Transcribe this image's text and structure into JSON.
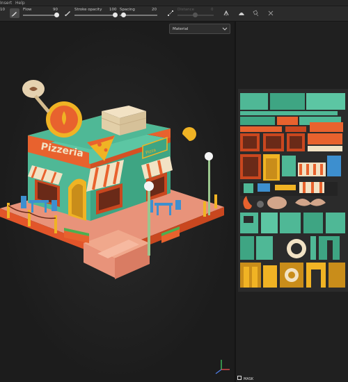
{
  "menu": {
    "items": [
      "Insert",
      "Help"
    ]
  },
  "toolbar": {
    "flow": {
      "label": "Flow",
      "value": "90",
      "pct": 0.9
    },
    "size_value": "10",
    "stroke_opacity": {
      "label": "Stroke opacity",
      "value": "100",
      "pct": 1.0
    },
    "spacing": {
      "label": "Spacing",
      "value": "20",
      "pct": 0.0
    },
    "distance": {
      "label": "Distance",
      "value": "0",
      "pct": 0.5,
      "enabled": false
    },
    "icons": [
      "brush-icon",
      "pen-pressure-icon",
      "symmetry-icon",
      "lazy-mouse-icon",
      "stencil-icon",
      "camera-icon",
      "settings-icon"
    ]
  },
  "viewport_panel": {
    "channel_select": "Material"
  },
  "texture_panel": {
    "mask_label": "MASK"
  },
  "scene": {
    "sign_text": "Pizzeria",
    "roof_sign_text": "Pizza",
    "colors": {
      "teal": "#4fb896",
      "orange": "#e8622e",
      "cream": "#f2e2c4",
      "yellow": "#f0b324",
      "plaza": "#e8937a",
      "plaza_edge": "#e2552a"
    }
  }
}
